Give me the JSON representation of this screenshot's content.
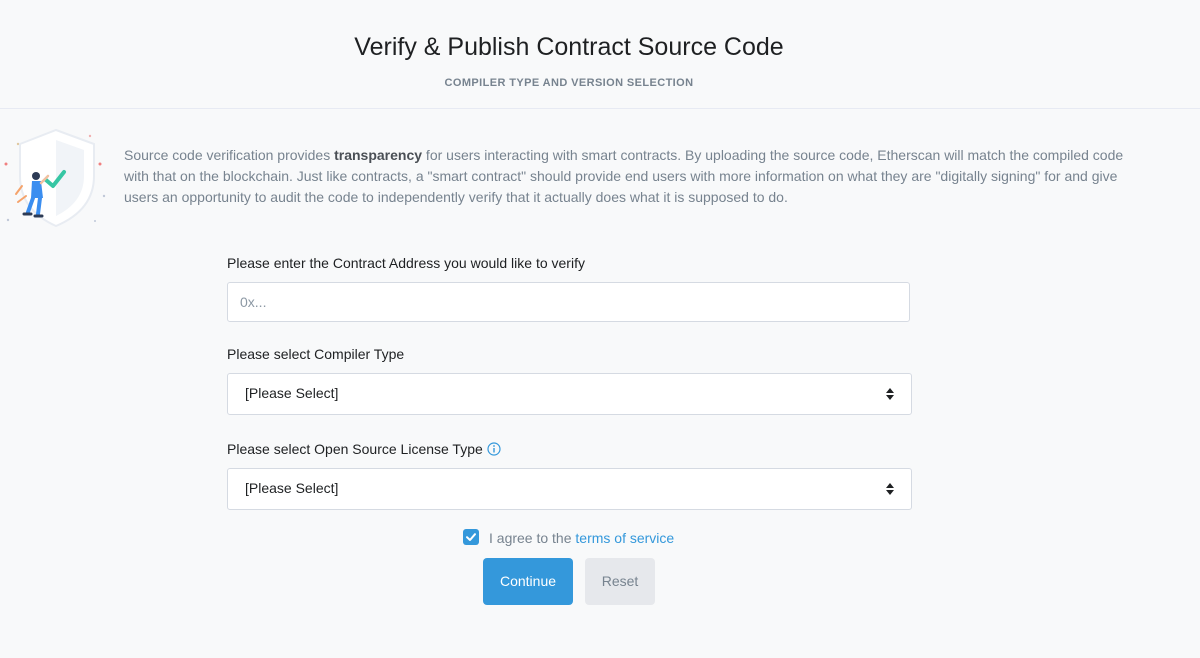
{
  "header": {
    "title": "Verify & Publish Contract Source Code",
    "subtitle": "COMPILER TYPE AND VERSION SELECTION"
  },
  "intro": {
    "text_before": "Source code verification provides ",
    "bold": "transparency",
    "text_after": " for users interacting with smart contracts. By uploading the source code, Etherscan will match the compiled code with that on the blockchain. Just like contracts, a \"smart contract\" should provide end users with more information on what they are \"digitally signing\" for and give users an opportunity to audit the code to independently verify that it actually does what it is supposed to do."
  },
  "form": {
    "address_label": "Please enter the Contract Address you would like to verify",
    "address_placeholder": "0x...",
    "address_value": "",
    "compiler_label": "Please select Compiler Type",
    "compiler_value": "[Please Select]",
    "license_label": "Please select Open Source License Type",
    "license_value": "[Please Select]",
    "agree_prefix": "I agree to the ",
    "agree_link": "terms of service",
    "agree_checked": true,
    "continue_label": "Continue",
    "reset_label": "Reset"
  },
  "colors": {
    "accent": "#3498db",
    "muted_text": "#77838f",
    "background": "#f8f9fa"
  },
  "icons": [
    "shield-illustration",
    "info-icon",
    "checkmark-icon",
    "sort-caret-icon"
  ]
}
